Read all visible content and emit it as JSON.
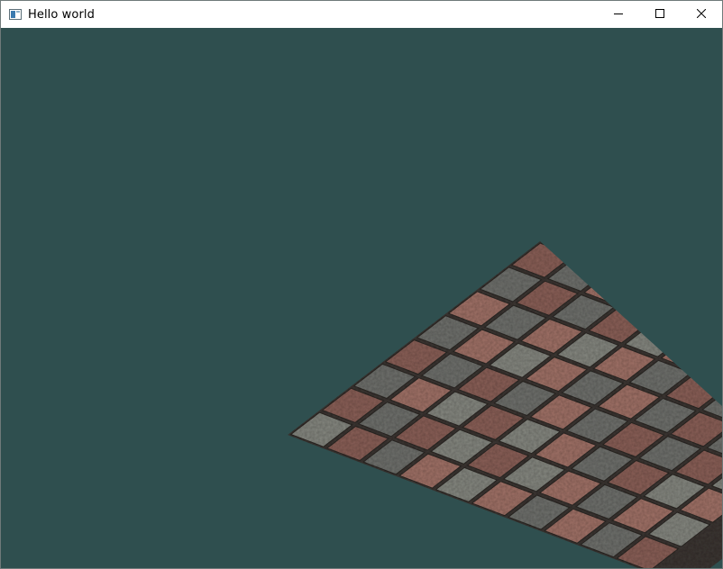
{
  "window": {
    "title": "Hello world",
    "icon": "app-window-icon",
    "controls": [
      "minimize-icon",
      "maximize-icon",
      "close-icon"
    ]
  },
  "canvas": {
    "clear_color": "#2f4f4f",
    "quad_texture": "paving-stone-checker",
    "tile_colors": {
      "red": "#8a6058",
      "gray": "#6f716d",
      "grout": "#3d3835",
      "red_speckle": "#a07268",
      "gray_speckle": "#858780"
    }
  }
}
